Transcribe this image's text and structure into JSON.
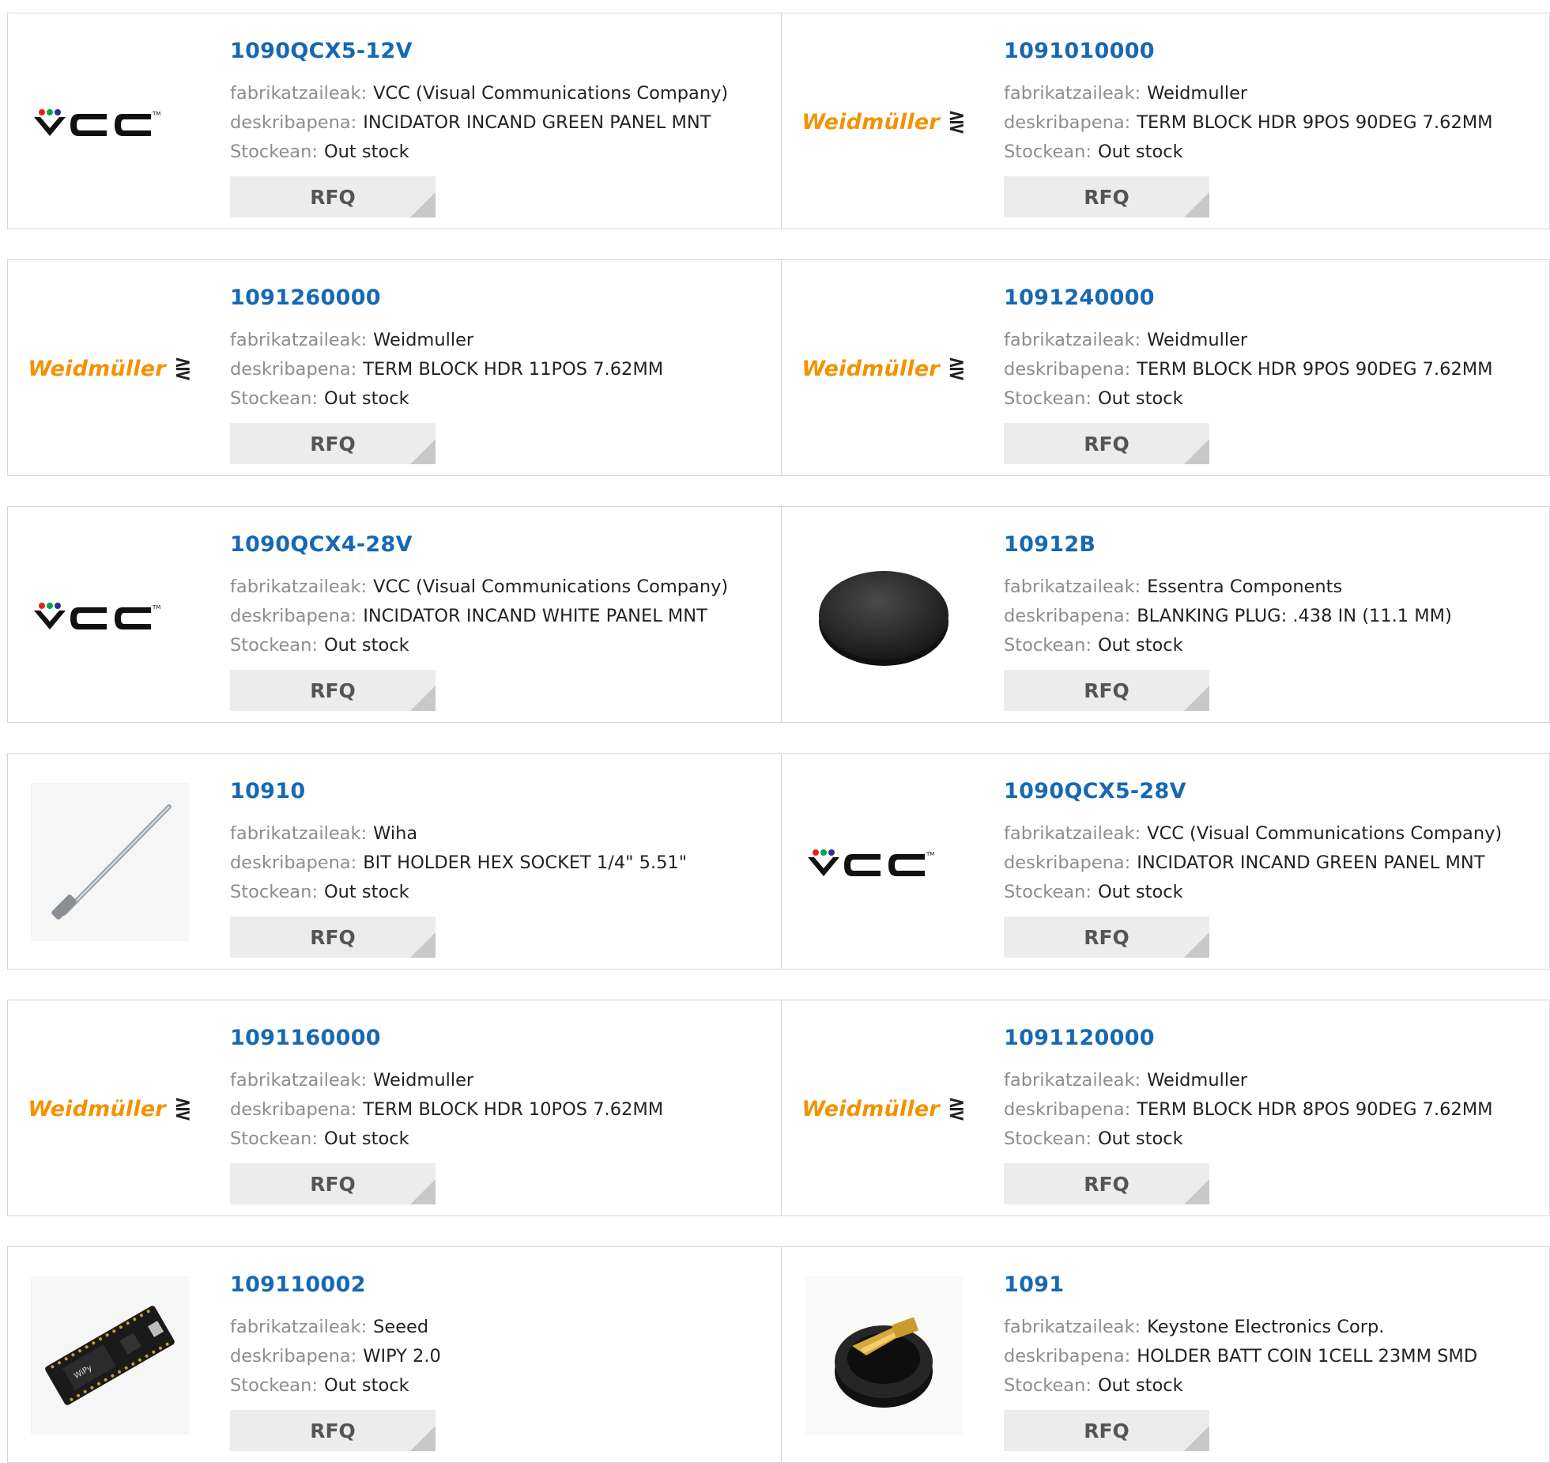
{
  "labels": {
    "manufacturer": "fabrikatzaileak:",
    "description": "deskribapena:",
    "stock": "Stockean:",
    "rfq": "RFQ"
  },
  "colors": {
    "part_link": "#1668b4",
    "label_gray": "#8d8d8d",
    "rfq_bg": "#ececec",
    "weidmuller_orange": "#f39200"
  },
  "products": [
    {
      "part": "1090QCX5-12V",
      "manufacturer": "VCC (Visual Communications Company)",
      "description": "INCIDATOR INCAND GREEN PANEL MNT",
      "stock": "Out stock",
      "image": "vcc-logo",
      "logo_text": "VCC"
    },
    {
      "part": "1091010000",
      "manufacturer": "Weidmuller",
      "description": "TERM BLOCK HDR 9POS 90DEG 7.62MM",
      "stock": "Out stock",
      "image": "weidmuller-logo",
      "logo_text": "Weidmüller"
    },
    {
      "part": "1091260000",
      "manufacturer": "Weidmuller",
      "description": "TERM BLOCK HDR 11POS 7.62MM",
      "stock": "Out stock",
      "image": "weidmuller-logo",
      "logo_text": "Weidmüller"
    },
    {
      "part": "1091240000",
      "manufacturer": "Weidmuller",
      "description": "TERM BLOCK HDR 9POS 90DEG 7.62MM",
      "stock": "Out stock",
      "image": "weidmuller-logo",
      "logo_text": "Weidmüller"
    },
    {
      "part": "1090QCX4-28V",
      "manufacturer": "VCC (Visual Communications Company)",
      "description": "INCIDATOR INCAND WHITE PANEL MNT",
      "stock": "Out stock",
      "image": "vcc-logo",
      "logo_text": "VCC"
    },
    {
      "part": "10912B",
      "manufacturer": "Essentra Components",
      "description": "BLANKING PLUG: .438 IN (11.1 MM)",
      "stock": "Out stock",
      "image": "blanking-plug-photo"
    },
    {
      "part": "10910",
      "manufacturer": "Wiha",
      "description": "BIT HOLDER HEX SOCKET 1/4\" 5.51\"",
      "stock": "Out stock",
      "image": "bit-holder-photo"
    },
    {
      "part": "1090QCX5-28V",
      "manufacturer": "VCC (Visual Communications Company)",
      "description": "INCIDATOR INCAND GREEN PANEL MNT",
      "stock": "Out stock",
      "image": "vcc-logo",
      "logo_text": "VCC"
    },
    {
      "part": "1091160000",
      "manufacturer": "Weidmuller",
      "description": "TERM BLOCK HDR 10POS 7.62MM",
      "stock": "Out stock",
      "image": "weidmuller-logo",
      "logo_text": "Weidmüller"
    },
    {
      "part": "1091120000",
      "manufacturer": "Weidmuller",
      "description": "TERM BLOCK HDR 8POS 90DEG 7.62MM",
      "stock": "Out stock",
      "image": "weidmuller-logo",
      "logo_text": "Weidmüller"
    },
    {
      "part": "109110002",
      "manufacturer": "Seeed",
      "description": "WIPY 2.0",
      "stock": "Out stock",
      "image": "dev-board-photo"
    },
    {
      "part": "1091",
      "manufacturer": "Keystone Electronics Corp.",
      "description": "HOLDER BATT COIN 1CELL 23MM SMD",
      "stock": "Out stock",
      "image": "coin-cell-holder-photo"
    }
  ]
}
